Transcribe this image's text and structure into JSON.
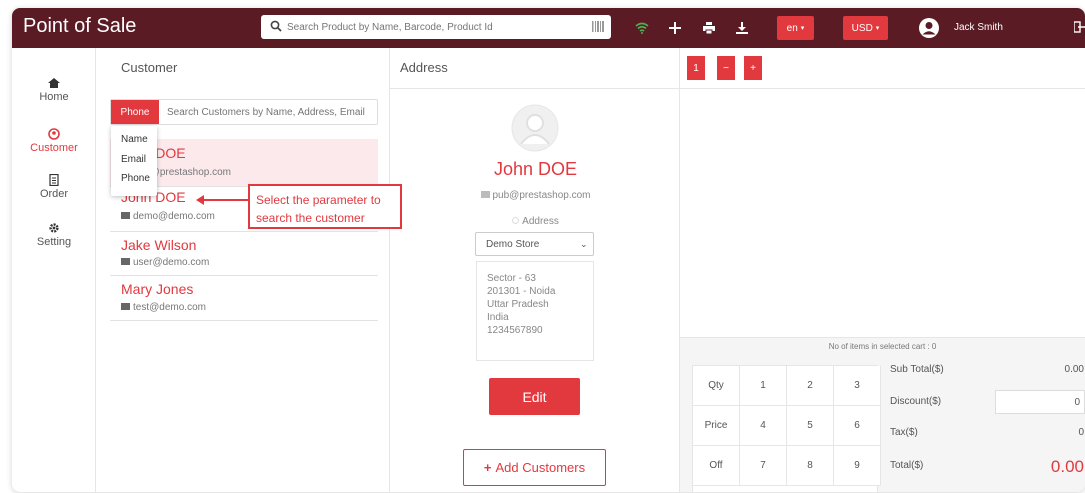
{
  "app": {
    "title": "Point of Sale"
  },
  "search": {
    "placeholder": "Search Product by Name, Barcode, Product Id"
  },
  "topbar": {
    "language": "en",
    "currency": "USD",
    "user_name": "Jack Smith"
  },
  "sidebar": {
    "items": [
      {
        "label": "Home",
        "icon": "home-icon",
        "active": false
      },
      {
        "label": "Customer",
        "icon": "user-icon",
        "active": true
      },
      {
        "label": "Order",
        "icon": "receipt-icon",
        "active": false
      },
      {
        "label": "Setting",
        "icon": "gear-icon",
        "active": false
      }
    ]
  },
  "customer": {
    "heading": "Customer",
    "search_mode": "Phone",
    "search_placeholder": "Search Customers by Name, Address, Email",
    "dropdown_options": [
      "Name",
      "Email",
      "Phone"
    ],
    "list": [
      {
        "name": "John DOE",
        "email": "pub@prestashop.com",
        "selected": true
      },
      {
        "name": "John DOE",
        "email": "demo@demo.com",
        "selected": false
      },
      {
        "name": "Jake Wilson",
        "email": "user@demo.com",
        "selected": false
      },
      {
        "name": "Mary Jones",
        "email": "test@demo.com",
        "selected": false
      }
    ]
  },
  "annotation": {
    "line1": "Select the parameter to",
    "line2": "search the customer"
  },
  "address": {
    "heading": "Address",
    "name": "John DOE",
    "email": "pub@prestashop.com",
    "label": "Address",
    "selected": "Demo Store",
    "lines": [
      "Sector - 63",
      "201301 - Noida",
      "Uttar Pradesh",
      "India",
      "1234567890"
    ],
    "edit_label": "Edit",
    "add_label": "Add Customers"
  },
  "cart": {
    "tabs": [
      "1",
      "−",
      "+"
    ],
    "items_count_text": "No of items in selected cart : 0",
    "keypad": [
      [
        "Qty",
        "1",
        "2",
        "3"
      ],
      [
        "Price",
        "4",
        "5",
        "6"
      ],
      [
        "Off",
        "7",
        "8",
        "9"
      ]
    ],
    "subtotal_label": "Sub Total($)",
    "subtotal_value": "0.00",
    "discount_label": "Discount($)",
    "discount_value": "0",
    "tax_label": "Tax($)",
    "tax_value": "0",
    "total_label": "Total($)",
    "total_value": "0.00"
  },
  "colors": {
    "brand": "#5a1b24",
    "accent": "#e2393f"
  }
}
